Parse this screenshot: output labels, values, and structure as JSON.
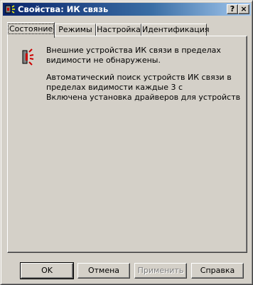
{
  "window": {
    "title": "Свойства: ИК связь",
    "help_label": "?",
    "close_label": "×"
  },
  "tabs": [
    {
      "label": "Состояние",
      "active": true
    },
    {
      "label": "Режимы",
      "active": false
    },
    {
      "label": "Настройка",
      "active": false
    },
    {
      "label": "Идентификация",
      "active": false
    }
  ],
  "status": {
    "message_lines": [
      "Внешние устройства ИК связи в пределах",
      "видимости не обнаружены."
    ],
    "info_lines": [
      "Автоматический поиск устройств ИК связи в",
      "пределах видимости каждые 3 с",
      "Включена установка драйверов для устройств"
    ]
  },
  "buttons": {
    "ok": "OK",
    "cancel": "Отмена",
    "apply": "Применить",
    "help": "Справка"
  },
  "colors": {
    "title_start": "#0a246a",
    "title_end": "#a6caf0",
    "face": "#d4d0c8",
    "ir_red": "#cc0000"
  }
}
